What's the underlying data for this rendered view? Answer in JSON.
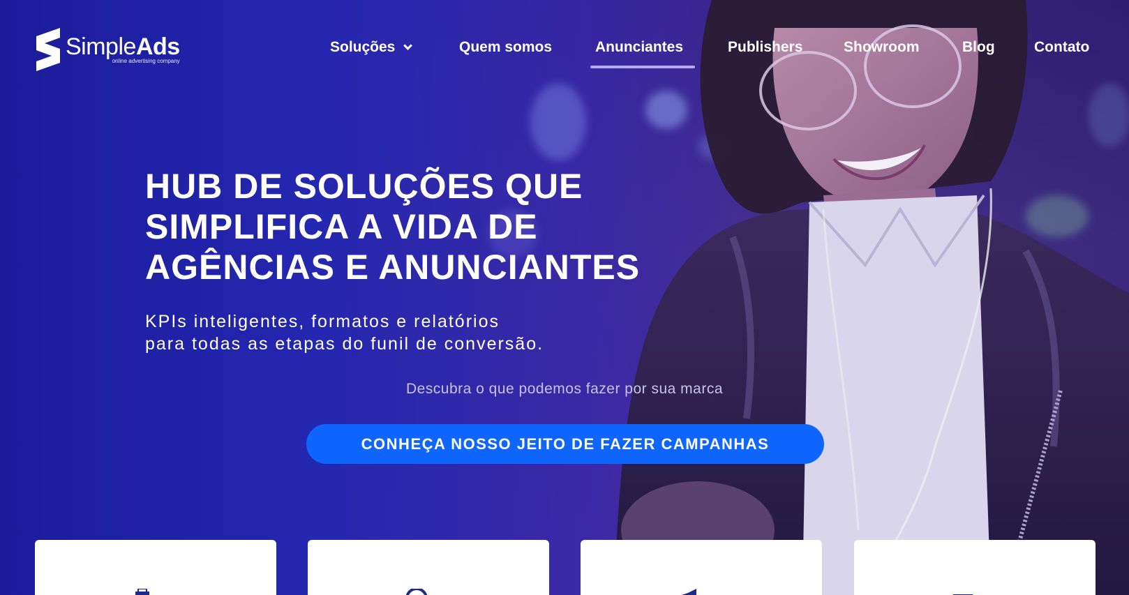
{
  "brand": {
    "name_light": "Simple",
    "name_bold": "Ads",
    "tagline": "online advertising company",
    "accent": "#0f66ff"
  },
  "nav": {
    "items": [
      {
        "label": "Soluções",
        "has_dropdown": true
      },
      {
        "label": "Quem somos"
      },
      {
        "label": "Anunciantes",
        "active": true
      },
      {
        "label": "Publishers"
      },
      {
        "label": "Showroom"
      },
      {
        "label": "Blog"
      },
      {
        "label": "Contato"
      }
    ]
  },
  "hero": {
    "headline": [
      "HUB DE SOLUÇÕES QUE",
      "SIMPLIFICA A VIDA DE",
      "AGÊNCIAS E ANUNCIANTES"
    ],
    "subtitle": [
      "KPIs inteligentes, formatos e relatórios",
      "para todas as etapas do funil de conversão."
    ],
    "discover": "Descubra o que podemos fazer por sua marca",
    "cta": "CONHEÇA NOSSO JEITO DE FAZER CAMPANHAS"
  },
  "cards": [
    {
      "icon": "printer-icon"
    },
    {
      "icon": "circle-icon"
    },
    {
      "icon": "megaphone-icon"
    },
    {
      "icon": "monitor-icon"
    }
  ]
}
